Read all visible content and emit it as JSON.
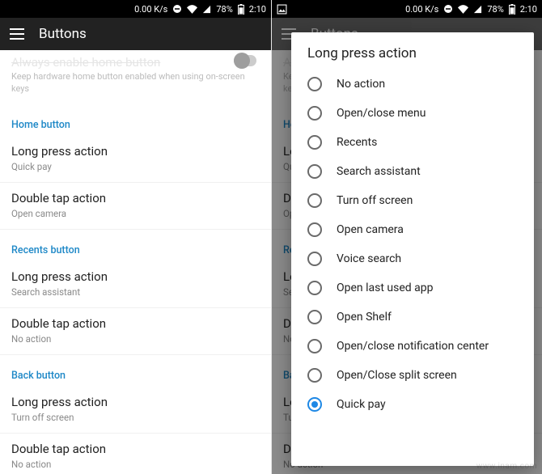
{
  "status": {
    "speed": "0.00 K/s",
    "battery_pct": "78%",
    "time": "2:10"
  },
  "left": {
    "app_bar_title": "Buttons",
    "cut_setting": {
      "title": "Always enable home button",
      "sub": "Keep hardware home button enabled when using on-screen keys"
    },
    "sections": [
      {
        "header": "Home button",
        "items": [
          {
            "title": "Long press action",
            "sub": "Quick pay"
          },
          {
            "title": "Double tap action",
            "sub": "Open camera"
          }
        ]
      },
      {
        "header": "Recents button",
        "items": [
          {
            "title": "Long press action",
            "sub": "Search assistant"
          },
          {
            "title": "Double tap action",
            "sub": "No action"
          }
        ]
      },
      {
        "header": "Back button",
        "items": [
          {
            "title": "Long press action",
            "sub": "Turn off screen"
          },
          {
            "title": "Double tap action",
            "sub": "No action"
          }
        ]
      }
    ]
  },
  "right": {
    "dialog_title": "Long press action",
    "options": [
      {
        "label": "No action",
        "selected": false
      },
      {
        "label": "Open/close menu",
        "selected": false
      },
      {
        "label": "Recents",
        "selected": false
      },
      {
        "label": "Search assistant",
        "selected": false
      },
      {
        "label": "Turn off screen",
        "selected": false
      },
      {
        "label": "Open camera",
        "selected": false
      },
      {
        "label": "Voice search",
        "selected": false
      },
      {
        "label": "Open last used app",
        "selected": false
      },
      {
        "label": "Open Shelf",
        "selected": false
      },
      {
        "label": "Open/close notification center",
        "selected": false
      },
      {
        "label": "Open/Close split screen",
        "selected": false
      },
      {
        "label": "Quick pay",
        "selected": true
      }
    ]
  },
  "watermark": "www.inam.com"
}
